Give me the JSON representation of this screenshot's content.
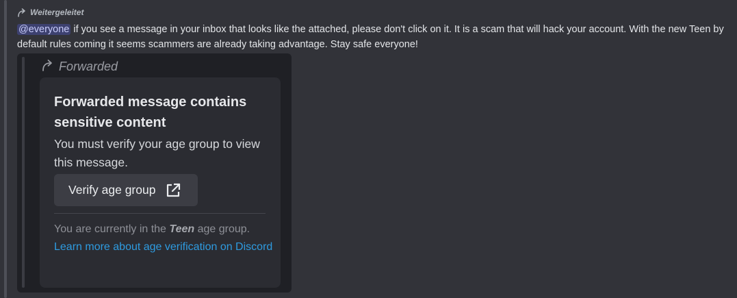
{
  "forward_header": {
    "label": "Weitergeleitet",
    "icon": "forward-arrow-icon"
  },
  "message": {
    "mention": "@everyone",
    "text": " if you see a message in your inbox that looks like the attached, please don't click on it. It is a scam that will hack your account. With the new Teen by default rules coming it seems scammers are already taking advantage. Stay safe everyone!"
  },
  "embed": {
    "forward_label": "Forwarded",
    "icon": "forward-arrow-icon",
    "card": {
      "title": "Forwarded message contains sensitive content",
      "body": "You must verify your age group to view this message.",
      "button_label": "Verify age group",
      "button_icon": "external-link-icon",
      "footer_prefix": "You are currently in the ",
      "footer_group": "Teen",
      "footer_suffix": " age group.",
      "link_text": "Learn more about age verification on Discord"
    }
  },
  "colors": {
    "background": "#323339",
    "embed_background": "#1f2025",
    "card_background": "#2b2c32",
    "button_background": "#3c3d44",
    "link": "#2e9be0",
    "mention_background": "#4a4f85"
  }
}
